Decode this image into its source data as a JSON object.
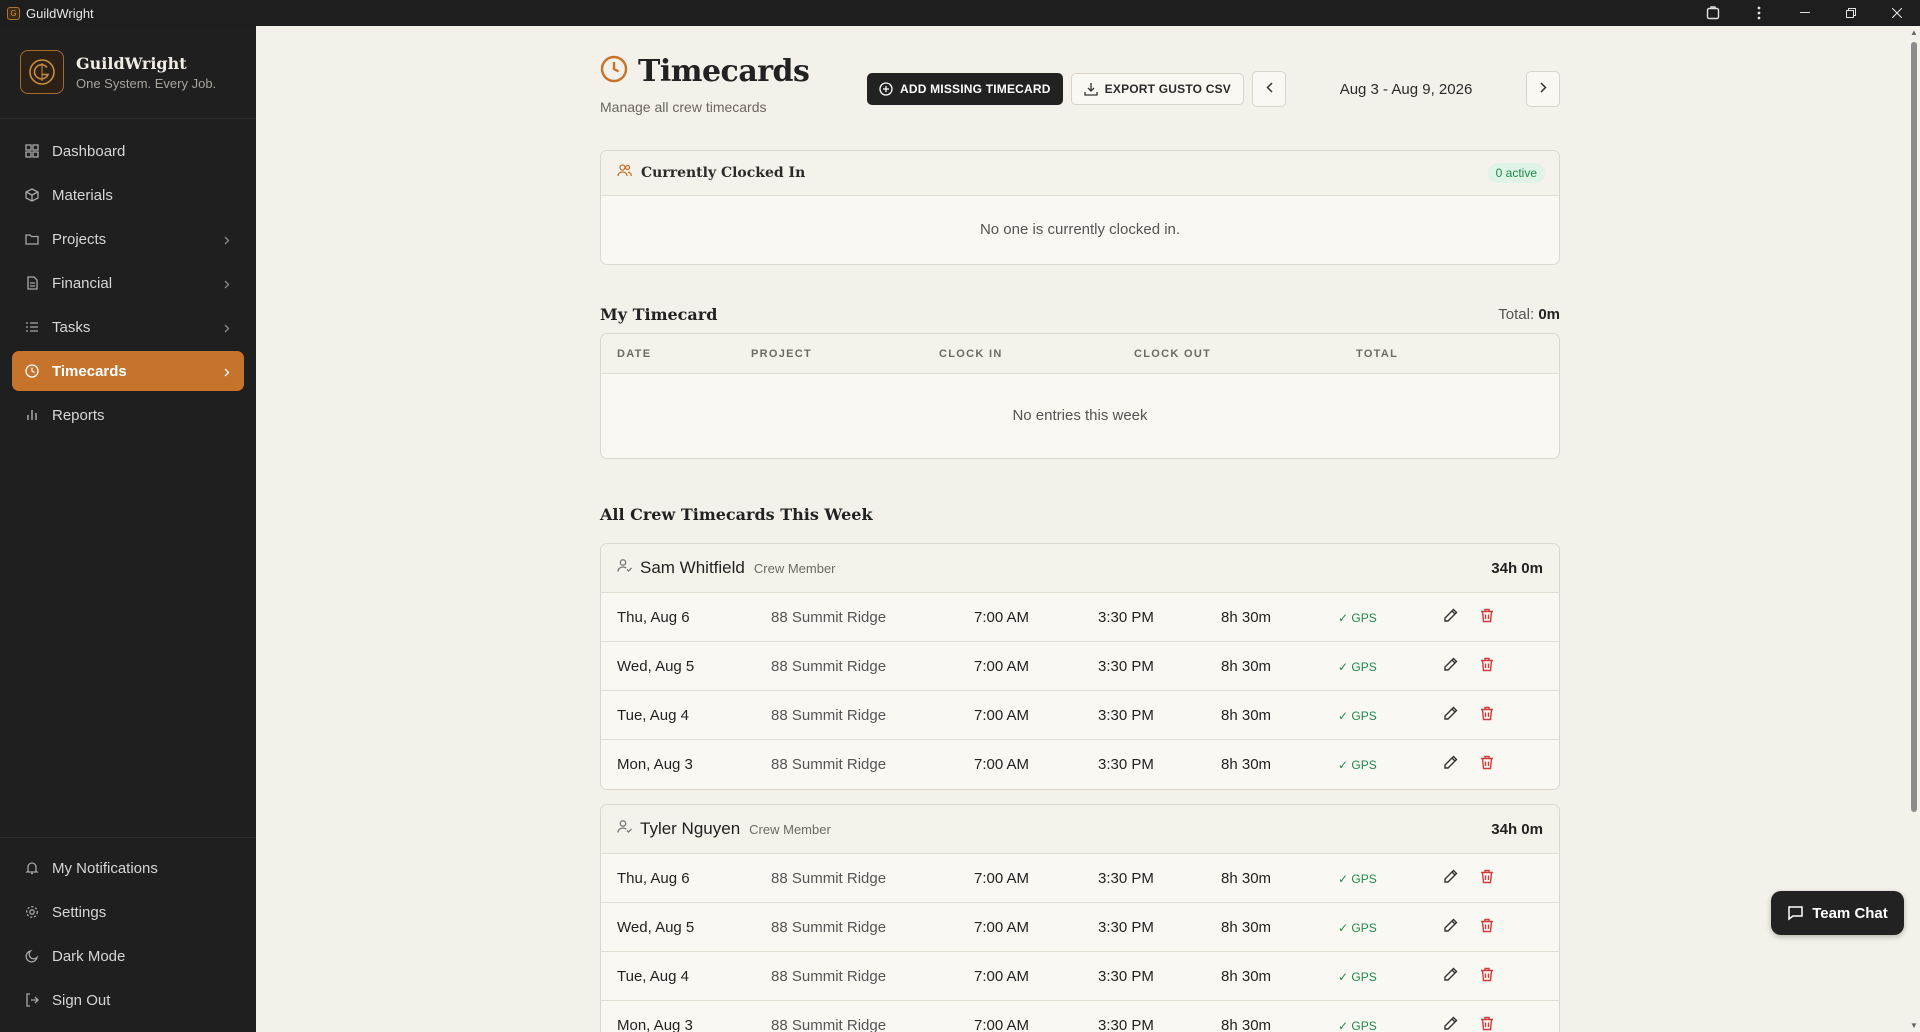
{
  "window": {
    "title": "GuildWright"
  },
  "brand": {
    "name": "GuildWright",
    "tagline": "One System. Every Job."
  },
  "nav": {
    "items": [
      {
        "label": "Dashboard",
        "icon": "dashboard-icon"
      },
      {
        "label": "Materials",
        "icon": "box-icon"
      },
      {
        "label": "Projects",
        "icon": "folder-icon"
      },
      {
        "label": "Financial",
        "icon": "document-icon"
      },
      {
        "label": "Tasks",
        "icon": "list-icon"
      },
      {
        "label": "Timecards",
        "icon": "clock-icon",
        "active": true
      },
      {
        "label": "Reports",
        "icon": "bar-chart-icon"
      }
    ],
    "bottom": [
      {
        "label": "My Notifications",
        "icon": "bell-icon"
      },
      {
        "label": "Settings",
        "icon": "gear-icon"
      },
      {
        "label": "Dark Mode",
        "icon": "moon-icon"
      },
      {
        "label": "Sign Out",
        "icon": "sign-out-icon"
      }
    ]
  },
  "page": {
    "title": "Timecards",
    "subtitle": "Manage all crew timecards",
    "add_missing_label": "ADD MISSING TIMECARD",
    "export_label": "EXPORT GUSTO CSV",
    "date_range": "Aug 3 - Aug 9, 2026"
  },
  "clocked_in": {
    "title": "Currently Clocked In",
    "badge": "0 active",
    "empty": "No one is currently clocked in."
  },
  "my_timecard": {
    "title": "My Timecard",
    "total_label": "Total:",
    "total_value": "0m",
    "columns": [
      "DATE",
      "PROJECT",
      "CLOCK IN",
      "CLOCK OUT",
      "TOTAL"
    ],
    "empty": "No entries this week"
  },
  "crew_section": {
    "title": "All Crew Timecards This Week",
    "gps_label": "✓ GPS",
    "members": [
      {
        "name": "Sam Whitfield",
        "role": "Crew Member",
        "total": "34h 0m",
        "entries": [
          {
            "date": "Thu, Aug 6",
            "project": "88 Summit Ridge",
            "clock_in": "7:00 AM",
            "clock_out": "3:30 PM",
            "total": "8h 30m"
          },
          {
            "date": "Wed, Aug 5",
            "project": "88 Summit Ridge",
            "clock_in": "7:00 AM",
            "clock_out": "3:30 PM",
            "total": "8h 30m"
          },
          {
            "date": "Tue, Aug 4",
            "project": "88 Summit Ridge",
            "clock_in": "7:00 AM",
            "clock_out": "3:30 PM",
            "total": "8h 30m"
          },
          {
            "date": "Mon, Aug 3",
            "project": "88 Summit Ridge",
            "clock_in": "7:00 AM",
            "clock_out": "3:30 PM",
            "total": "8h 30m"
          }
        ]
      },
      {
        "name": "Tyler Nguyen",
        "role": "Crew Member",
        "total": "34h 0m",
        "entries": [
          {
            "date": "Thu, Aug 6",
            "project": "88 Summit Ridge",
            "clock_in": "7:00 AM",
            "clock_out": "3:30 PM",
            "total": "8h 30m"
          },
          {
            "date": "Wed, Aug 5",
            "project": "88 Summit Ridge",
            "clock_in": "7:00 AM",
            "clock_out": "3:30 PM",
            "total": "8h 30m"
          },
          {
            "date": "Tue, Aug 4",
            "project": "88 Summit Ridge",
            "clock_in": "7:00 AM",
            "clock_out": "3:30 PM",
            "total": "8h 30m"
          },
          {
            "date": "Mon, Aug 3",
            "project": "88 Summit Ridge",
            "clock_in": "7:00 AM",
            "clock_out": "3:30 PM",
            "total": "8h 30m"
          }
        ]
      }
    ]
  },
  "team_chat": {
    "label": "Team Chat"
  },
  "colors": {
    "accent": "#c6732b",
    "sidebar_bg": "#1f1f1f",
    "page_bg": "#f4f1ea",
    "gps_green": "#1f8a4c",
    "delete_red": "#d23b3b"
  }
}
